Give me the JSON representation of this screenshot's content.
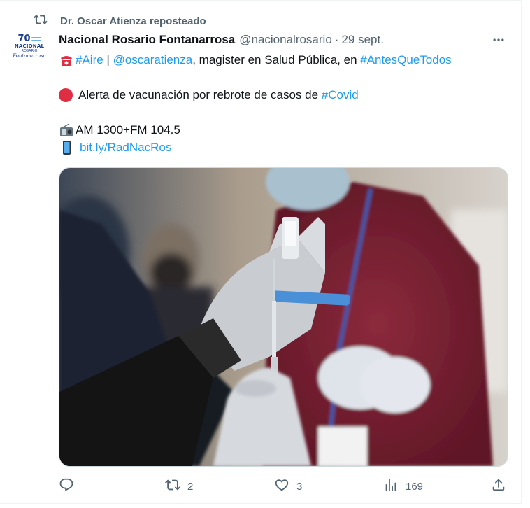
{
  "repost": {
    "label": "Dr. Oscar Atienza reposteado",
    "icon": "repost-icon"
  },
  "avatar": {
    "number": "70",
    "line1": "NACIONAL",
    "line2": "ROSARIO",
    "line3": "Fontanarrosa"
  },
  "tweet": {
    "author": "Nacional Rosario Fontanarrosa",
    "handle": "@nacionalrosario",
    "separator": "·",
    "date": "29 sept.",
    "more_icon": "more-icon",
    "line1": {
      "emoji": "☎️",
      "hashtag_aire": "#Aire",
      "pipe": " | ",
      "mention": "@oscaratienza",
      "text": ", magister en Salud Pública, en ",
      "hashtag_antes": "#AntesQueTodos"
    },
    "line2": {
      "text": "Alerta de vacunación por rebrote de casos de ",
      "hashtag_covid": "#Covid"
    },
    "line3": {
      "text": "AM 1300+FM 104.5"
    },
    "line4": {
      "link": "bit.ly/RadNacRos"
    }
  },
  "media": {
    "alt_icon": "vaccination-photo"
  },
  "actions": {
    "reply_count": "",
    "repost_count": "2",
    "like_count": "3",
    "views_count": "169"
  },
  "colors": {
    "accent": "#1d9bf0",
    "muted": "#536471",
    "text": "#0f1419",
    "alert_red": "#dd2e44"
  }
}
